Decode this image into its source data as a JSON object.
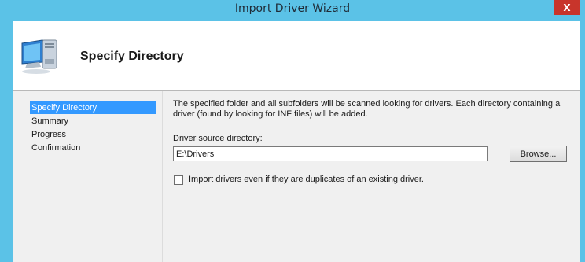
{
  "window": {
    "title": "Import Driver Wizard",
    "close_label": "X"
  },
  "header": {
    "icon": "computer-icon",
    "title": "Specify Directory"
  },
  "nav": {
    "items": [
      {
        "label": "Specify Directory",
        "active": true
      },
      {
        "label": "Summary",
        "active": false
      },
      {
        "label": "Progress",
        "active": false
      },
      {
        "label": "Confirmation",
        "active": false
      }
    ]
  },
  "content": {
    "description": "The specified folder and all subfolders will be scanned looking for drivers.  Each directory containing a driver (found by looking for INF files) will be added.",
    "source_label": "Driver source directory:",
    "source_value": "E:\\Drivers",
    "browse_label": "Browse...",
    "duplicates_label": "Import drivers even if they are duplicates of an existing driver.",
    "duplicates_checked": false
  },
  "colors": {
    "title_bar": "#5bc2e7",
    "close_button": "#c8352b",
    "selection": "#3399ff"
  }
}
